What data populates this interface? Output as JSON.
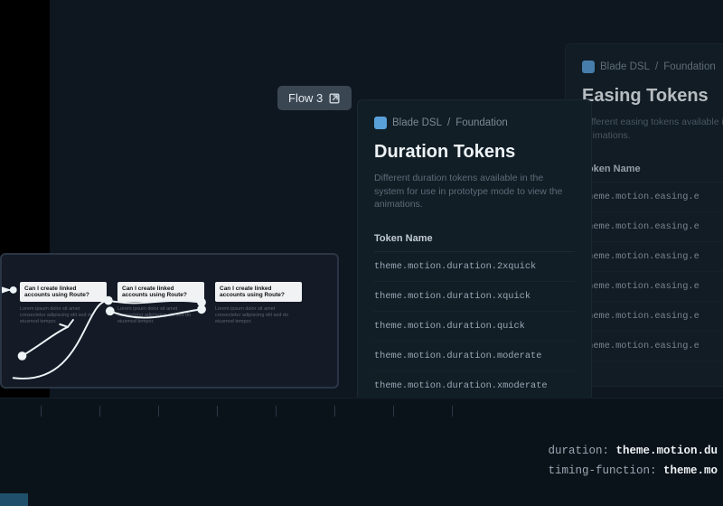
{
  "flow_tag": {
    "label": "Flow 3",
    "icon": "open-external-icon"
  },
  "panels": {
    "duration": {
      "breadcrumb_brand": "Blade DSL",
      "breadcrumb_section": "Foundation",
      "title": "Duration Tokens",
      "description": "Different duration tokens available in the system for use in prototype mode to view the animations.",
      "column_header": "Token Name",
      "rows": [
        "theme.motion.duration.2xquick",
        "theme.motion.duration.xquick",
        "theme.motion.duration.quick",
        "theme.motion.duration.moderate",
        "theme.motion.duration.xmoderate"
      ]
    },
    "easing": {
      "breadcrumb_brand": "Blade DSL",
      "breadcrumb_section": "Foundation",
      "title": "Easing Tokens",
      "description": "Different easing tokens available in the animations.",
      "column_header": "Token Name",
      "rows": [
        "theme.motion.easing.e",
        "theme.motion.easing.e",
        "theme.motion.easing.e",
        "theme.motion.easing.e",
        "theme.motion.easing.e",
        "theme.motion.easing.e"
      ]
    }
  },
  "flow_card": {
    "columns": [
      {
        "question": "Can I create linked accounts using Route?",
        "blurb": "Lorem ipsum dolor sit amet consectetur adipiscing elit sed do eiusmod tempor."
      },
      {
        "question": "Can I create linked accounts using Route?",
        "blurb": "Lorem ipsum dolor sit amet consectetur adipiscing elit sed do eiusmod tempor."
      },
      {
        "question": "Can I create linked accounts using Route?",
        "blurb": "Lorem ipsum dolor sit amet consectetur adipiscing elit sed do eiusmod tempor."
      }
    ]
  },
  "code_snippet": {
    "line1_key": "duration:",
    "line1_val": "theme.motion.du",
    "line2_key": "timing-function:",
    "line2_val": "theme.mo"
  },
  "ruler_ticks": [
    45,
    110,
    175,
    240,
    305,
    370,
    435,
    500
  ]
}
